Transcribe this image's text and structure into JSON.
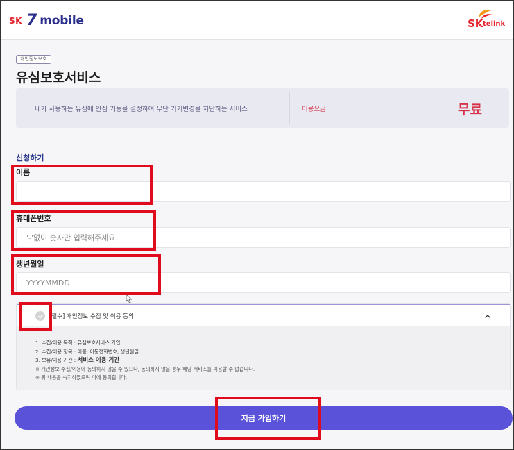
{
  "header": {
    "brand_sk": "SK",
    "brand_seven": "7",
    "brand_mobile": "mobile",
    "partner_sk": "SK",
    "partner_telink": "telink"
  },
  "page": {
    "tag": "개인정보보호",
    "title": "유심보호서비스"
  },
  "info": {
    "description": "내가 사용하는 유심에 안심 기능을 설정하여 무단 기기변경을 차단하는 서비스",
    "fee_label": "이용요금",
    "fee_value": "무료"
  },
  "form": {
    "section_title": "신청하기",
    "name_label": "이름",
    "name_value": "",
    "phone_label": "휴대폰번호",
    "phone_placeholder": "'-'없이 숫자만 입력해주세요.",
    "birth_label": "생년월일",
    "birth_placeholder": "YYYYMMDD"
  },
  "consent": {
    "title": "[필수] 개인정보 수집 및 이용 동의",
    "line1": "1. 수집/이용 목적 : 유심보호서비스 가입",
    "line2": "2. 수집/이용 항목 : 이름, 이동전화번호, 생년월일",
    "line3_prefix": "3. 보유/이용 기간 : ",
    "line3_strong": "서비스 이용 기간",
    "note1": "※ 개인정보 수집/이용에 동의하지 않을 수 있으나, 동의하지 않을 경우 해당 서비스를 이용할 수 없습니다.",
    "note2": "※ 위 내용을 숙지하였으며 이에 동의합니다."
  },
  "submit": {
    "label": "지금 가입하기"
  },
  "colors": {
    "accent": "#5a52d8",
    "brand_navy": "#2b2f8c",
    "brand_red": "#e5232b",
    "highlight_red": "#e00b1d"
  },
  "icons": {
    "check": "check-icon",
    "chevron": "chevron-up-icon",
    "cursor": "mouse-cursor-icon"
  }
}
